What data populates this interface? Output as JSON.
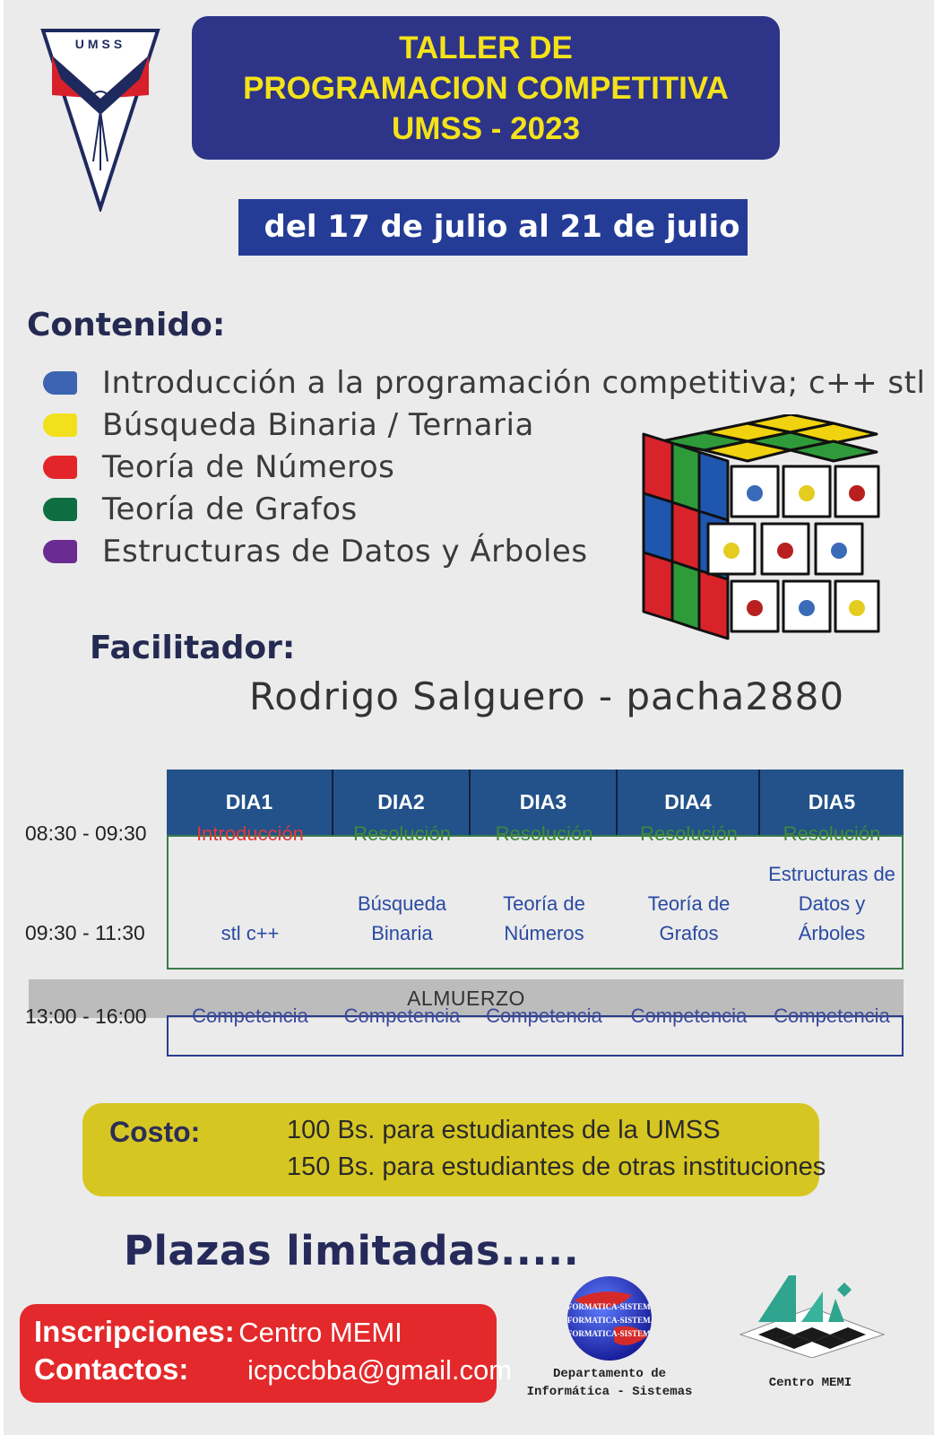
{
  "logo": {
    "text": "UMSS",
    "colors": {
      "red": "#d8202a",
      "navy": "#1e2a5e"
    }
  },
  "header": {
    "title_lines": [
      "TALLER DE",
      "PROGRAMACION COMPETITIVA",
      "UMSS - 2023"
    ],
    "dates": "del 17 de julio al 21 de julio"
  },
  "contenido": {
    "heading": "Contenido:",
    "topics": [
      {
        "label": "Introducción a la programación competitiva; c++ stl",
        "color": "#3c64b0"
      },
      {
        "label": "Búsqueda Binaria / Ternaria",
        "color": "#f2e01c"
      },
      {
        "label": "Teoría de Números",
        "color": "#e3252a"
      },
      {
        "label": "Teoría de Grafos",
        "color": "#0e6e42"
      },
      {
        "label": "Estructuras de Datos y Árboles",
        "color": "#6a2c90"
      }
    ]
  },
  "facilitador": {
    "heading": "Facilitador:",
    "name": "Rodrigo Salguero - pacha2880"
  },
  "schedule": {
    "days": [
      "DIA1",
      "DIA2",
      "DIA3",
      "DIA4",
      "DIA5"
    ],
    "times": [
      "08:30 - 09:30",
      "09:30 - 11:30",
      "13:00 - 16:00"
    ],
    "morning": [
      "Introducción",
      "Resolución",
      "Resolución",
      "Resolución",
      "Resolución"
    ],
    "topics": [
      [
        "stl c++"
      ],
      [
        "Búsqueda",
        "Binaria"
      ],
      [
        "Teoría de",
        "Números"
      ],
      [
        "Teoría de",
        "Grafos"
      ],
      [
        "Estructuras de",
        "Datos y",
        "Árboles"
      ]
    ],
    "lunch": "ALMUERZO",
    "afternoon": [
      "Competencia",
      "Competencia",
      "Competencia",
      "Competencia",
      "Competencia"
    ]
  },
  "costo": {
    "label": "Costo:",
    "lines": [
      "100 Bs. para estudiantes de la UMSS",
      "150 Bs. para estudiantes de otras instituciones"
    ]
  },
  "plazas": "Plazas limitadas.....",
  "contact": {
    "insc_label": "Inscripciones:",
    "insc_value": "Centro MEMI",
    "contact_label": "Contactos:",
    "contact_value": "icpccbba@gmail.com"
  },
  "logos": {
    "dept_globe_text": [
      "INFORMATICA-SISTEMAS",
      "INFORMATICA-SISTEMAS",
      "INFORMATICA-SISTEMAS"
    ],
    "dept_caption": [
      "Departamento de",
      "Informática - Sistemas"
    ],
    "memi_caption": "Centro MEMI"
  }
}
